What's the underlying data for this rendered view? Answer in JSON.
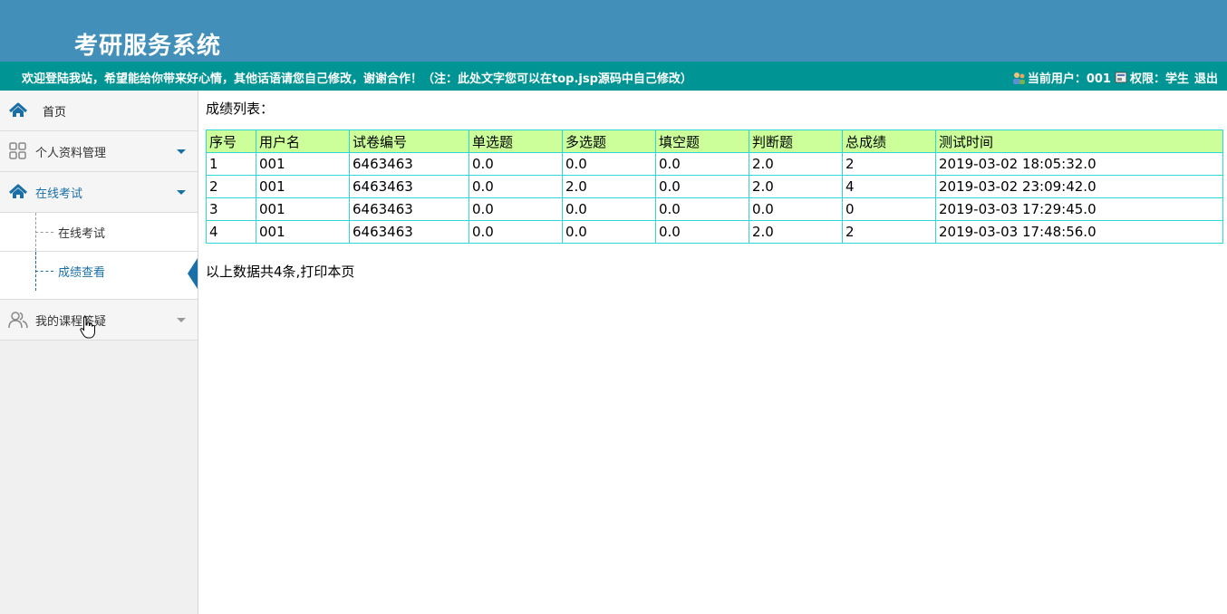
{
  "app": {
    "title": "考研服务系统"
  },
  "infobar": {
    "welcome": "欢迎登陆我站，希望能给你带来好心情，其他话语请您自己修改，谢谢合作！（注：此处文字您可以在top.jsp源码中自己修改）",
    "current_user_label": "当前用户：001",
    "permission_label": "权限：学生",
    "logout_label": "退出"
  },
  "sidebar": {
    "home": "首页",
    "items": [
      {
        "label": "个人资料管理",
        "icon": "grid-icon"
      },
      {
        "label": "在线考试",
        "icon": "home-icon"
      },
      {
        "label": "我的课程答疑",
        "icon": "users-icon"
      }
    ],
    "submenu": [
      {
        "label": "在线考试"
      },
      {
        "label": "成绩查看"
      }
    ]
  },
  "main": {
    "list_title": "成绩列表：",
    "columns": [
      "序号",
      "用户名",
      "试卷编号",
      "单选题",
      "多选题",
      "填空题",
      "判断题",
      "总成绩",
      "测试时间"
    ],
    "rows": [
      [
        "1",
        "001",
        "6463463",
        "0.0",
        "0.0",
        "0.0",
        "2.0",
        "2",
        "2019-03-02 18:05:32.0"
      ],
      [
        "2",
        "001",
        "6463463",
        "0.0",
        "2.0",
        "0.0",
        "2.0",
        "4",
        "2019-03-02 23:09:42.0"
      ],
      [
        "3",
        "001",
        "6463463",
        "0.0",
        "0.0",
        "0.0",
        "0.0",
        "0",
        "2019-03-03 17:29:45.0"
      ],
      [
        "4",
        "001",
        "6463463",
        "0.0",
        "0.0",
        "0.0",
        "2.0",
        "2",
        "2019-03-03 17:48:56.0"
      ]
    ],
    "footer_text": "以上数据共4条,",
    "print_label": "打印本页"
  },
  "colors": {
    "header_bg": "#428fb9",
    "infobar_bg": "#009494",
    "accent": "#1a6fa6",
    "table_header_bg": "#ccff99",
    "table_border": "#2fd6d6"
  }
}
